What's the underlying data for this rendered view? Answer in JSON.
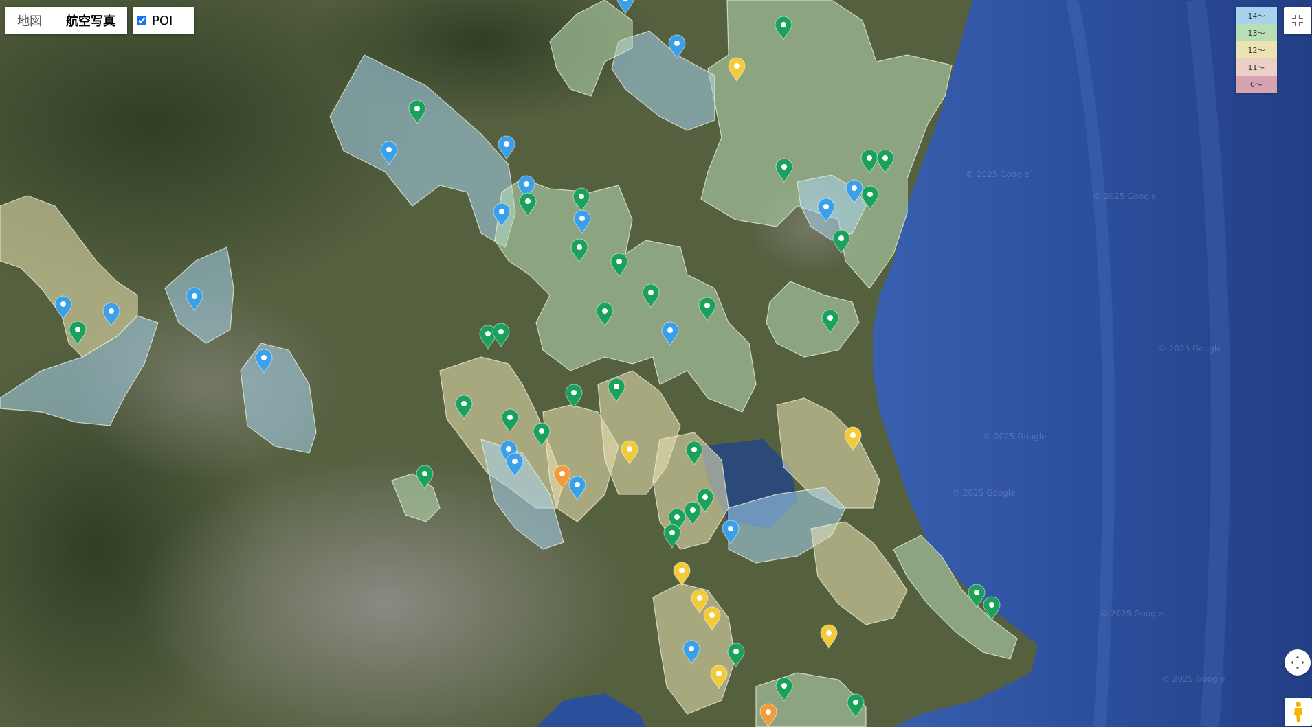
{
  "map_controls": {
    "map_type": [
      "地図",
      "航空写真"
    ],
    "active_map_type": "航空写真",
    "poi_label": "POI",
    "poi_checked": true
  },
  "legend": [
    {
      "label": "14〜",
      "color": "#a7d3ee"
    },
    {
      "label": "13〜",
      "color": "#b9ddb4"
    },
    {
      "label": "12〜",
      "color": "#ece3b3"
    },
    {
      "label": "11〜",
      "color": "#eccfc6"
    },
    {
      "label": "0〜",
      "color": "#d5a4b0"
    }
  ],
  "attribution": "© 2025 Google",
  "icons": {
    "fullscreen": "exit-fullscreen-icon",
    "camera": "camera-control-icon",
    "pegman": "pegman-icon"
  },
  "colors": {
    "sea": "#2c4f9c",
    "land": "#4d5a3a",
    "marker_green": "#1aa15c",
    "marker_blue": "#3aa0ea",
    "marker_yellow": "#f3cb3a",
    "marker_orange": "#f39a3a"
  }
}
